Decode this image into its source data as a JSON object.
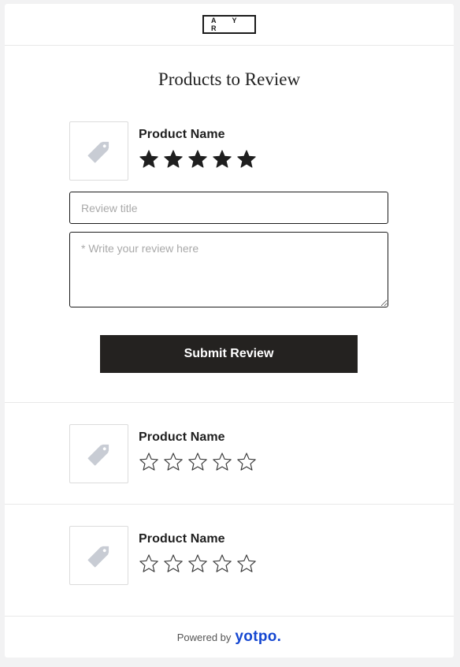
{
  "brand": {
    "logo_text": "A Y R"
  },
  "page": {
    "title": "Products to Review"
  },
  "products": [
    {
      "name": "Product Name",
      "rating": 5,
      "rating_max": 5
    },
    {
      "name": "Product Name",
      "rating": 0,
      "rating_max": 5
    },
    {
      "name": "Product Name",
      "rating": 0,
      "rating_max": 5
    }
  ],
  "form": {
    "title_placeholder": "Review title",
    "body_placeholder": "* Write your review here",
    "submit_label": "Submit Review"
  },
  "footer": {
    "powered_by": "Powered by",
    "provider": "yotpo."
  },
  "icons": {
    "thumbnail": "price-tag-icon",
    "star_filled": "star-filled-icon",
    "star_empty": "star-outline-icon"
  },
  "colors": {
    "button": "#242220",
    "yotpo_blue": "#1547d1",
    "star": "#1f1f1f",
    "placeholder_icon": "#c8ccd4"
  }
}
